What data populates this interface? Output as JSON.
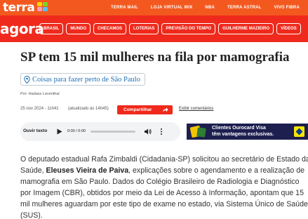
{
  "topbar": {
    "logo_text": "terra",
    "links": [
      "TERRA MAIL",
      "LOJA VIRTUAL WIX",
      "NBA",
      "TERRA ASTRAL",
      "VIVO FIBRA"
    ]
  },
  "navbar": {
    "brand": "agora",
    "items": [
      "BRASIL",
      "MUNDO",
      "CHECAMOS",
      "LOTERIAS",
      "PREVISÃO DO TEMPO",
      "GUILHERME MAZIEIRO",
      "VÍDEOS"
    ]
  },
  "article": {
    "title": "SP tem 15 mil mulheres na fila por mamografia",
    "local_chip": "Coisas para fazer perto de São Paulo",
    "author": "Por: Hadass Leventhal",
    "date": "25 nov 2024 - 11h41",
    "updated": "(atualizado às 14h45)",
    "share_label": "Compartilhar",
    "comments_label": "Exibir comentários",
    "body": {
      "line1": "O deputado estadual Rafa Zimbaldi (Cidadania-SP) solicitou ao secretário de Estado da",
      "line2_pre": "Saúde, ",
      "line2_bold": "Eleuses Vieira de Paiva",
      "line2_post": ", explicações sobre o agendamento e a realização de",
      "line3": "mamografia em São Paulo. Dados do Colégio Brasileiro de Radiologia e Diagnóstico",
      "line4": "por Imagem (CBR), obtidos por meio da Lei de Acesso à Informação, apontam que 15",
      "line5": "mil mulheres aguardam por este tipo de exame no estado, via Sistema Único de Saúde",
      "line6": "(SUS)."
    }
  },
  "player": {
    "label": "Ouvir texto",
    "time": "0:00 / 0:00",
    "progress": 0
  },
  "ad": {
    "line1": "Clientes Ourocard Visa",
    "line2": "têm vantagens exclusivas."
  },
  "colors": {
    "topbar": "#f3591f",
    "navbar": "#ef2a1c",
    "link": "#1f6fb6",
    "share_button": "#ef2a1c"
  }
}
